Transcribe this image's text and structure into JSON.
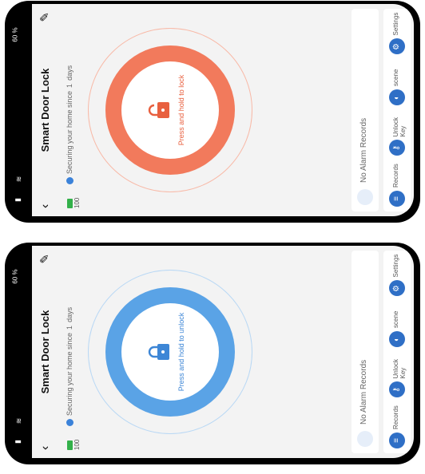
{
  "screens": [
    {
      "title": "Smart Door Lock",
      "subtitle_prefix": "Securing your home since",
      "subtitle_days": "1",
      "subtitle_suffix": "days",
      "battery_percent": "100",
      "action_text": "Press and hold to lock",
      "alarm_text": "No Alarm Records",
      "system_battery": "60 %",
      "theme": {
        "ring": "#f27a5c",
        "ring_light": "#f8b9a7",
        "text": "#e8603f"
      },
      "tabs": [
        {
          "label": "Records",
          "icon": "records-icon"
        },
        {
          "label": "Unlock Key",
          "icon": "key-icon"
        },
        {
          "label": "scene",
          "icon": "toggle-icon"
        },
        {
          "label": "Settings",
          "icon": "gear-icon"
        }
      ]
    },
    {
      "title": "Smart Door Lock",
      "subtitle_prefix": "Securing your home since",
      "subtitle_days": "1",
      "subtitle_suffix": "days",
      "battery_percent": "100",
      "action_text": "Press and hold to unlock",
      "alarm_text": "No Alarm Records",
      "system_battery": "60 %",
      "theme": {
        "ring": "#5aa3e6",
        "ring_light": "#b9d8f4",
        "text": "#3d86d6"
      },
      "tabs": [
        {
          "label": "Records",
          "icon": "records-icon"
        },
        {
          "label": "Unlock Key",
          "icon": "key-icon"
        },
        {
          "label": "scene",
          "icon": "toggle-icon"
        },
        {
          "label": "Settings",
          "icon": "gear-icon"
        }
      ]
    }
  ]
}
